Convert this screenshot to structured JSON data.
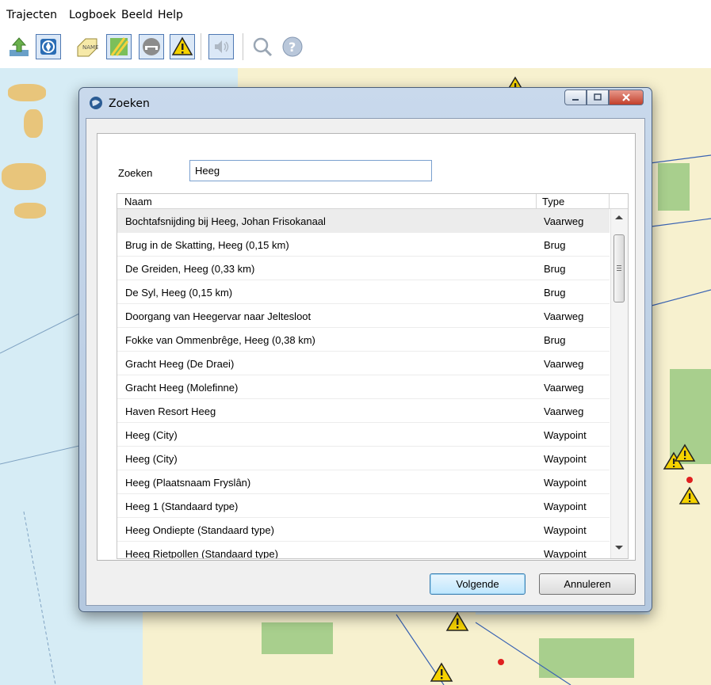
{
  "menu": {
    "items": [
      "Trajecten",
      "Logboek",
      "Beeld",
      "Help"
    ]
  },
  "toolbar": {
    "buttons": [
      {
        "icon": "route-export-icon"
      },
      {
        "icon": "compass-icon",
        "pressed": true
      },
      {
        "icon": "name-tag-icon",
        "pressed": false
      },
      {
        "icon": "waterway-icon",
        "pressed": true
      },
      {
        "icon": "bridge-icon",
        "pressed": true
      },
      {
        "icon": "warning-icon",
        "pressed": true
      },
      {
        "icon": "sound-icon",
        "pressed": true
      },
      {
        "icon": "search-icon"
      },
      {
        "icon": "help-icon"
      }
    ]
  },
  "dialog": {
    "title": "Zoeken",
    "search_label": "Zoeken",
    "search_value": "Heeg",
    "columns": {
      "name": "Naam",
      "type": "Type"
    },
    "rows": [
      {
        "name": "Bochtafsnijding bij Heeg, Johan Frisokanaal",
        "type": "Vaarweg"
      },
      {
        "name": "Brug in de Skatting, Heeg (0,15 km)",
        "type": "Brug"
      },
      {
        "name": "De Greiden, Heeg (0,33 km)",
        "type": "Brug"
      },
      {
        "name": "De Syl, Heeg (0,15 km)",
        "type": "Brug"
      },
      {
        "name": "Doorgang van Heegervar naar Jeltesloot",
        "type": "Vaarweg"
      },
      {
        "name": "Fokke van Ommenbrêge, Heeg (0,38 km)",
        "type": "Brug"
      },
      {
        "name": "Gracht Heeg (De Draei)",
        "type": "Vaarweg"
      },
      {
        "name": "Gracht Heeg (Molefinne)",
        "type": "Vaarweg"
      },
      {
        "name": "Haven Resort Heeg",
        "type": "Vaarweg"
      },
      {
        "name": "Heeg (City)",
        "type": "Waypoint"
      },
      {
        "name": "Heeg (City)",
        "type": "Waypoint"
      },
      {
        "name": "Heeg (Plaatsnaam Fryslân)",
        "type": "Waypoint"
      },
      {
        "name": "Heeg 1 (Standaard type)",
        "type": "Waypoint"
      },
      {
        "name": "Heeg Ondiepte (Standaard type)",
        "type": "Waypoint"
      },
      {
        "name": "Heeg Rietpollen (Standaard type)",
        "type": "Waypoint"
      }
    ],
    "buttons": {
      "next": "Volgende",
      "cancel": "Annuleren"
    }
  },
  "colors": {
    "water": "#d6ecf5",
    "land": "#f7f1cf",
    "accent": "#3c7fb1",
    "close": "#c2402b"
  }
}
